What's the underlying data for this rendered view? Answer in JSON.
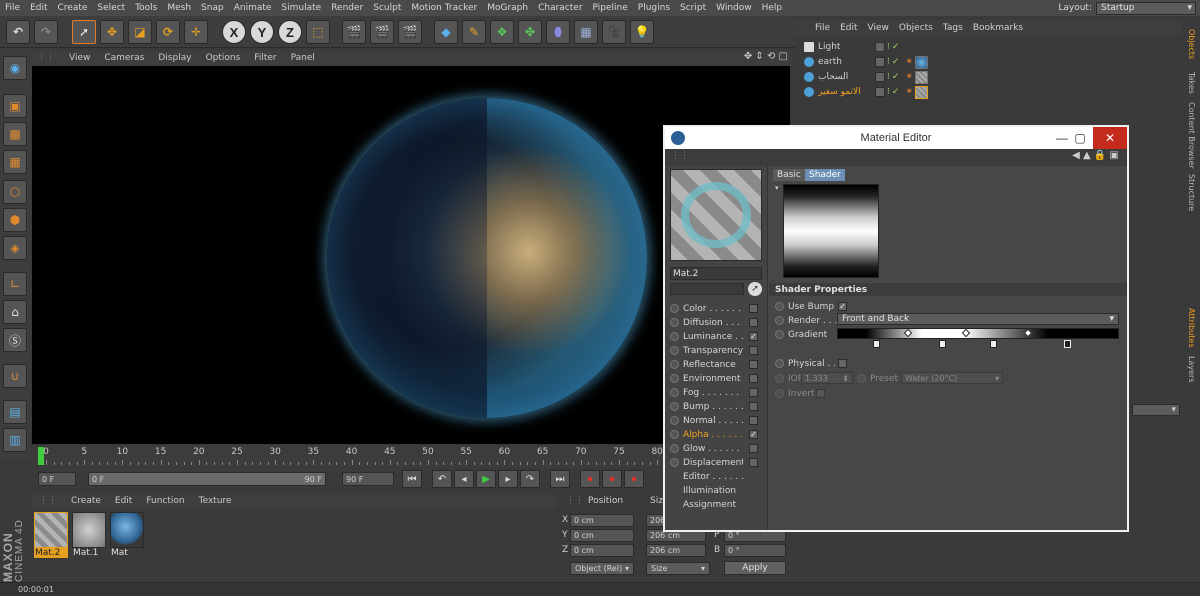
{
  "menubar": {
    "items": [
      "File",
      "Edit",
      "Create",
      "Select",
      "Tools",
      "Mesh",
      "Snap",
      "Animate",
      "Simulate",
      "Render",
      "Sculpt",
      "Motion Tracker",
      "MoGraph",
      "Character",
      "Pipeline",
      "Plugins",
      "Script",
      "Window",
      "Help"
    ],
    "layout_label": "Layout:",
    "layout_value": "Startup"
  },
  "toolbar": {
    "axis": [
      "X",
      "Y",
      "Z"
    ]
  },
  "viewport": {
    "menu": [
      "View",
      "Cameras",
      "Display",
      "Options",
      "Filter",
      "Panel"
    ]
  },
  "timeline": {
    "ticks": [
      "0",
      "5",
      "10",
      "15",
      "20",
      "25",
      "30",
      "35",
      "40",
      "45",
      "50",
      "55",
      "60",
      "65",
      "70",
      "75",
      "80"
    ],
    "start_field": "0 F",
    "range_start": "0 F",
    "range_end": "90 F",
    "end_field": "90 F"
  },
  "material_manager": {
    "menu": [
      "Create",
      "Edit",
      "Function",
      "Texture"
    ],
    "materials": [
      "Mat.2",
      "Mat.1",
      "Mat"
    ]
  },
  "brand": {
    "line1": "MAXON",
    "line2": "CINEMA 4D"
  },
  "coordinates": {
    "headers": [
      "Position",
      "Size"
    ],
    "rows": [
      {
        "axis": "X",
        "pos": "0 cm",
        "size": "206",
        "rot_axis": "H",
        "rot": "0 °"
      },
      {
        "axis": "Y",
        "pos": "0 cm",
        "size": "206 cm",
        "rot_axis": "P",
        "rot": "0 °"
      },
      {
        "axis": "Z",
        "pos": "0 cm",
        "size": "206 cm",
        "rot_axis": "B",
        "rot": "0 °"
      }
    ],
    "mode_drop": "Object (Rel)",
    "size_drop": "Size",
    "apply": "Apply"
  },
  "status": {
    "time": "00:00:01"
  },
  "object_manager": {
    "menu": [
      "File",
      "Edit",
      "View",
      "Objects",
      "Tags",
      "Bookmarks"
    ],
    "objects": [
      {
        "name": "Light",
        "type": "light"
      },
      {
        "name": "earth",
        "type": "sphere"
      },
      {
        "name": "السحاب",
        "type": "sphere"
      },
      {
        "name": "الاتمو سفير",
        "type": "sphere",
        "highlight": true
      }
    ]
  },
  "right_tabs": [
    "Objects",
    "Takes",
    "Content Browser",
    "Structure",
    "Attributes",
    "Layers"
  ],
  "material_editor": {
    "title": "Material Editor",
    "material_name": "Mat.2",
    "channels": [
      {
        "label": "Color . . . . . .",
        "checked": false
      },
      {
        "label": "Diffusion . . .",
        "checked": false
      },
      {
        "label": "Luminance . .",
        "checked": true
      },
      {
        "label": "Transparency",
        "checked": false
      },
      {
        "label": "Reflectance",
        "checked": false
      },
      {
        "label": "Environment",
        "checked": false
      },
      {
        "label": "Fog . . . . . . .",
        "checked": false
      },
      {
        "label": "Bump . . . . . .",
        "checked": false
      },
      {
        "label": "Normal . . . . .",
        "checked": false
      },
      {
        "label": "Alpha . . . . . .",
        "checked": true,
        "highlight": true
      },
      {
        "label": "Glow . . . . . .",
        "checked": false
      },
      {
        "label": "Displacement",
        "checked": false
      }
    ],
    "extra": [
      "Editor . . . . . .",
      "Illumination",
      "Assignment"
    ],
    "tabs": [
      "Basic",
      "Shader"
    ],
    "shader_properties_title": "Shader Properties",
    "use_bump_label": "Use Bump",
    "render_label": "Render . . .",
    "render_value": "Front and Back",
    "gradient_label": "Gradient",
    "physical_label": "Physical . . .",
    "ior_label": "IOR",
    "ior_value": "1.333",
    "preset_label": "Preset",
    "preset_value": "Water (20°C)",
    "invert_label": "Invert"
  }
}
